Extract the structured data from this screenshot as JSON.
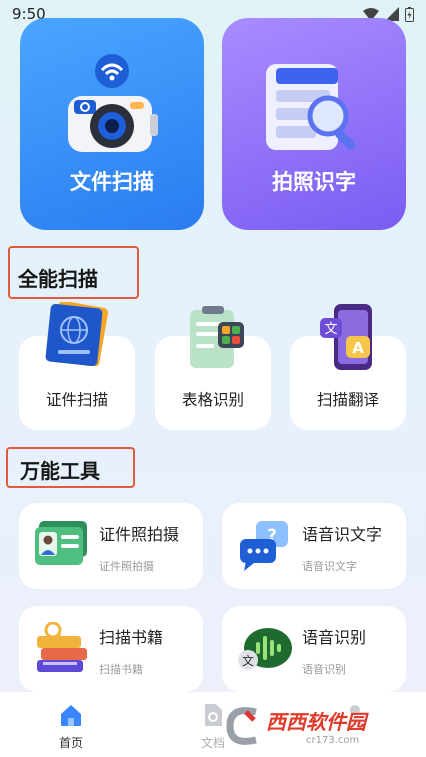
{
  "status_bar": {
    "time": "9:50"
  },
  "hero": {
    "scan_label": "文件扫描",
    "photo_label": "拍照识字"
  },
  "sections": {
    "all_scan": {
      "title": "全能扫描",
      "items": [
        {
          "label": "证件扫描",
          "icon": "passport-icon"
        },
        {
          "label": "表格识别",
          "icon": "spreadsheet-icon"
        },
        {
          "label": "扫描翻译",
          "icon": "translate-phone-icon"
        }
      ]
    },
    "tools": {
      "title": "万能工具",
      "items": [
        {
          "title": "证件照拍摄",
          "subtitle": "证件照拍摄",
          "icon": "id-card-icon"
        },
        {
          "title": "语音识文字",
          "subtitle": "语音识文字",
          "icon": "speech-bubble-icon"
        },
        {
          "title": "扫描书籍",
          "subtitle": "扫描书籍",
          "icon": "books-icon"
        },
        {
          "title": "语音识别",
          "subtitle": "语音识别",
          "icon": "voice-recognition-icon"
        }
      ]
    }
  },
  "bottom_nav": {
    "items": [
      {
        "label": "首页",
        "icon": "home-icon",
        "active": true
      },
      {
        "label": "文档",
        "icon": "document-icon",
        "active": false
      },
      {
        "label": "",
        "icon": "profile-icon",
        "active": false
      }
    ]
  },
  "watermark": {
    "text": "西西软件园",
    "url": "cr173.com"
  },
  "colors": {
    "accent": "#2a7cf0",
    "purple": "#7a5cf2",
    "highlight_box": "#e05a3b",
    "nav_active": "#3a86ff"
  }
}
